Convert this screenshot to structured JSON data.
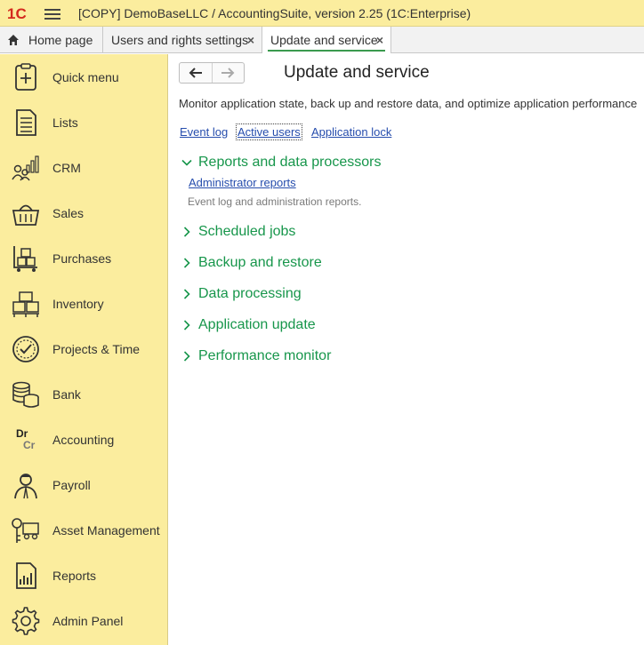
{
  "window": {
    "logo_text": "1С",
    "title": "[COPY] DemoBaseLLC / AccountingSuite, version 2.25  (1C:Enterprise)"
  },
  "tabs": [
    {
      "label": "Home page"
    },
    {
      "label": "Users and rights settings",
      "close": "×"
    },
    {
      "label": "Update and service",
      "close": "×"
    }
  ],
  "sidebar": {
    "items": [
      {
        "label": "Quick menu",
        "icon": "clipboard-plus-icon"
      },
      {
        "label": "Lists",
        "icon": "document-list-icon"
      },
      {
        "label": "CRM",
        "icon": "people-chart-icon"
      },
      {
        "label": "Sales",
        "icon": "basket-icon"
      },
      {
        "label": "Purchases",
        "icon": "cart-boxes-icon"
      },
      {
        "label": "Inventory",
        "icon": "pallet-boxes-icon"
      },
      {
        "label": "Projects & Time",
        "icon": "clock-check-icon"
      },
      {
        "label": "Bank",
        "icon": "coin-stack-icon"
      },
      {
        "label": "Accounting",
        "icon": "dr-cr-icon",
        "icon_text_top": "Dr",
        "icon_text_bottom": "Cr"
      },
      {
        "label": "Payroll",
        "icon": "employee-icon"
      },
      {
        "label": "Asset Management",
        "icon": "truck-key-icon"
      },
      {
        "label": "Reports",
        "icon": "report-chart-icon"
      },
      {
        "label": "Admin Panel",
        "icon": "gear-icon"
      }
    ]
  },
  "main": {
    "title": "Update and service",
    "description": "Monitor application state, back up and restore data, and optimize application performance",
    "links": [
      "Event log",
      "Active users",
      "Application lock"
    ],
    "sections": [
      {
        "title": "Reports and data processors",
        "expanded": true,
        "link": "Administrator reports",
        "description": "Event log and administration reports."
      },
      {
        "title": "Scheduled jobs",
        "expanded": false
      },
      {
        "title": "Backup and restore",
        "expanded": false
      },
      {
        "title": "Data processing",
        "expanded": false
      },
      {
        "title": "Application update",
        "expanded": false
      },
      {
        "title": "Performance monitor",
        "expanded": false
      }
    ]
  },
  "colors": {
    "panel_yellow": "#fbed9e",
    "section_green": "#17964b",
    "link_blue": "#264dad",
    "logo_red": "#d42a1e"
  }
}
